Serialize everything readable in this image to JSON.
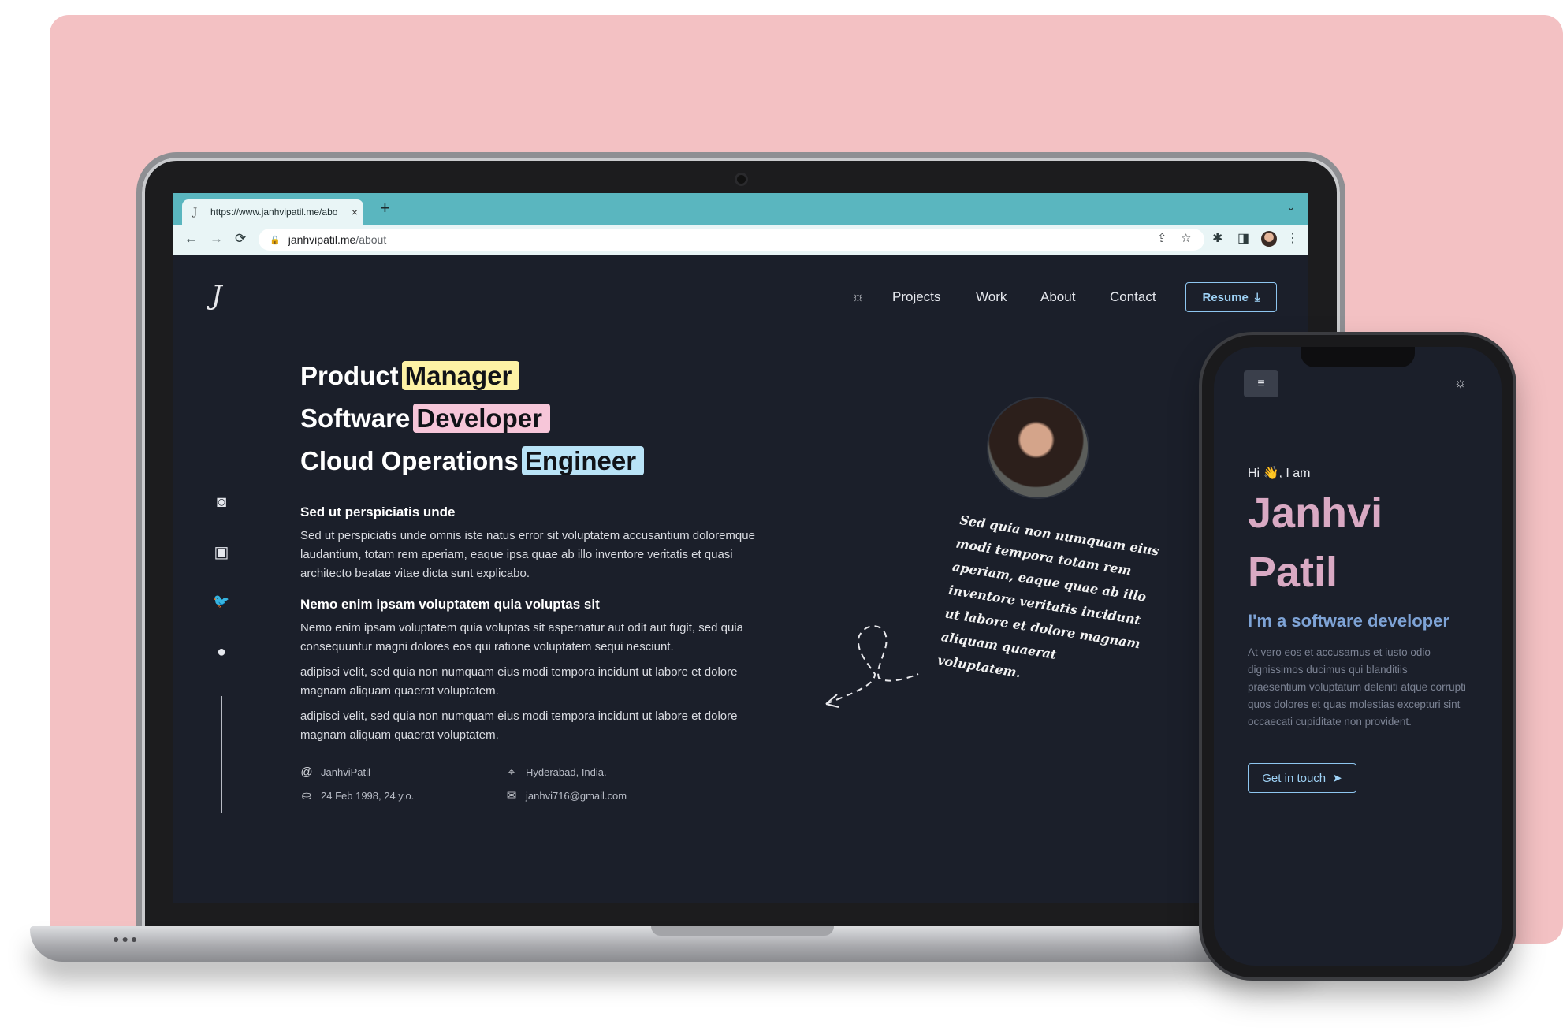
{
  "browser": {
    "tab_title": "https://www.janhvipatil.me/abo",
    "tab_close": "×",
    "new_tab": "+",
    "tab_menu": "⌄",
    "back": "←",
    "forward": "→",
    "reload": "⟳",
    "lock": "🔒",
    "address_domain": "janhvipatil.me",
    "address_path": "/about",
    "share": "⇪",
    "bookmark": "☆",
    "extensions": "✱",
    "sidepanel": "◨",
    "more": "⋮",
    "tab_bg_color": "#5ab6bf"
  },
  "site": {
    "logo": "J",
    "theme_icon": "☼",
    "nav": [
      "Projects",
      "Work",
      "About",
      "Contact"
    ],
    "resume_label": "Resume",
    "resume_icon": "⤓",
    "social_icons": [
      "instagram-icon",
      "linkedin-icon",
      "twitter-icon",
      "github-icon"
    ],
    "social_glyphs": [
      "◙",
      "▣",
      "🐦",
      "●"
    ],
    "headlines": [
      {
        "plain": "Product",
        "highlight": "Manager",
        "color": "#fdf2a5"
      },
      {
        "plain": "Software",
        "highlight": "Developer",
        "color": "#f7c6d9"
      },
      {
        "plain": "Cloud Operations",
        "highlight": "Engineer",
        "color": "#b9e3f7"
      }
    ],
    "subhead1": "Sed ut perspiciatis unde",
    "para1": "Sed ut perspiciatis unde omnis iste natus error sit voluptatem accusantium doloremque laudantium, totam rem aperiam, eaque ipsa quae ab illo inventore veritatis et quasi architecto beatae vitae dicta sunt explicabo.",
    "subhead2": "Nemo enim ipsam voluptatem quia voluptas sit",
    "para2": "Nemo enim ipsam voluptatem quia voluptas sit aspernatur aut odit aut fugit, sed quia consequuntur magni dolores eos qui ratione voluptatem sequi nesciunt.",
    "para3": "adipisci velit, sed quia non numquam eius modi tempora incidunt ut labore et dolore magnam aliquam quaerat voluptatem.",
    "para4": "adipisci velit, sed quia non numquam eius modi tempora incidunt ut labore et dolore magnam aliquam quaerat voluptatem.",
    "info": {
      "username": "JanhviPatil",
      "birthday": "24 Feb 1998, 24 y.o.",
      "location": "Hyderabad, India.",
      "email": "janhvi716@gmail.com"
    },
    "handwritten_note": "Sed quia non numquam eius modi tempora totam rem aperiam, eaque quae ab illo inventore veritatis incidunt ut labore et dolore magnam aliquam quaerat voluptatem."
  },
  "phone": {
    "menu_icon": "≡",
    "theme_icon": "☼",
    "greeting": "Hi 👋, I am",
    "first_name": "Janhvi",
    "last_name": "Patil",
    "role": "I'm a software developer",
    "description": "At vero eos et accusamus et iusto odio dignissimos ducimus qui blanditiis praesentium voluptatum deleniti atque corrupti quos dolores et quas molestias excepturi sint occaecati cupiditate non provident.",
    "cta_label": "Get in touch",
    "cta_icon": "➤"
  }
}
